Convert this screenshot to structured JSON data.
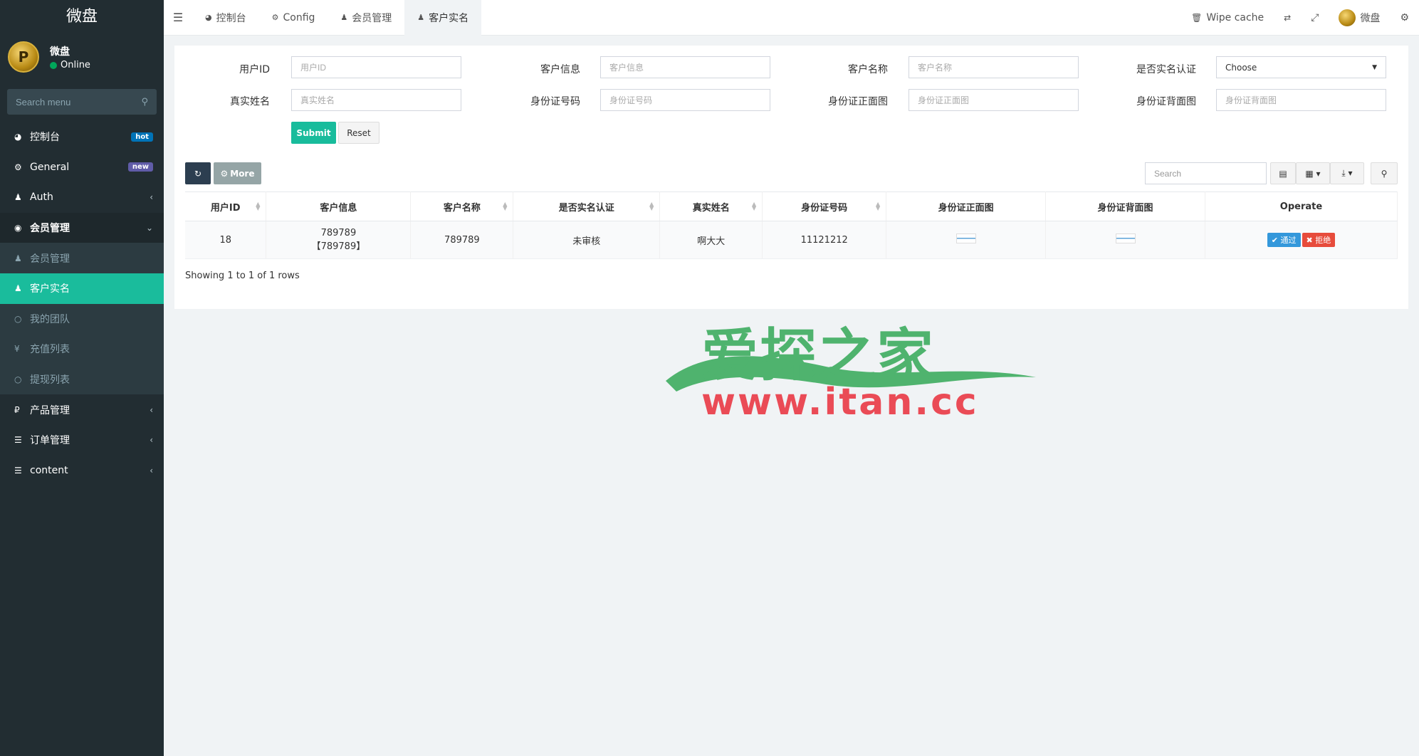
{
  "sidebar": {
    "brand": "微盘",
    "user": {
      "name": "微盘",
      "status": "Online",
      "avatar_letter": "P"
    },
    "search_placeholder": "Search menu",
    "items": [
      {
        "label": "控制台",
        "icon": "dashboard-icon",
        "badge": "hot"
      },
      {
        "label": "General",
        "icon": "cogs-icon",
        "badge": "new"
      },
      {
        "label": "Auth",
        "icon": "group-icon",
        "arrow": "‹"
      },
      {
        "label": "会员管理",
        "icon": "user-circle-icon",
        "arrow": "⌄"
      },
      {
        "label": "会员管理",
        "icon": "user-icon"
      },
      {
        "label": "客户实名",
        "icon": "user-icon"
      },
      {
        "label": "我的团队",
        "icon": "circle-icon"
      },
      {
        "label": "充值列表",
        "icon": "yen-icon"
      },
      {
        "label": "提现列表",
        "icon": "circle-icon"
      },
      {
        "label": "产品管理",
        "icon": "ruble-icon",
        "arrow": "‹"
      },
      {
        "label": "订单管理",
        "icon": "list-icon",
        "arrow": "‹"
      },
      {
        "label": "content",
        "icon": "list-icon",
        "arrow": "‹"
      }
    ]
  },
  "navbar": {
    "tabs": [
      {
        "label": "控制台"
      },
      {
        "label": "Config"
      },
      {
        "label": "会员管理"
      },
      {
        "label": "客户实名"
      }
    ],
    "wipe_cache": "Wipe cache",
    "user_name": "微盘"
  },
  "filter": {
    "fields": [
      {
        "label": "用户ID",
        "placeholder": "用户ID"
      },
      {
        "label": "客户信息",
        "placeholder": "客户信息"
      },
      {
        "label": "客户名称",
        "placeholder": "客户名称"
      },
      {
        "label": "是否实名认证",
        "select_value": "Choose"
      },
      {
        "label": "真实姓名",
        "placeholder": "真实姓名"
      },
      {
        "label": "身份证号码",
        "placeholder": "身份证号码"
      },
      {
        "label": "身份证正面图",
        "placeholder": "身份证正面图"
      },
      {
        "label": "身份证背面图",
        "placeholder": "身份证背面图"
      }
    ],
    "submit": "Submit",
    "reset": "Reset"
  },
  "toolbar": {
    "more": "More",
    "search_placeholder": "Search"
  },
  "table": {
    "headers": [
      "用户ID",
      "客户信息",
      "客户名称",
      "是否实名认证",
      "真实姓名",
      "身份证号码",
      "身份证正面图",
      "身份证背面图",
      "Operate"
    ],
    "rows": [
      {
        "id": "18",
        "info_line1": "789789",
        "info_line2": "【789789】",
        "name": "789789",
        "verified": "未审核",
        "real_name": "啊大大",
        "id_number": "11121212",
        "approve": "通过",
        "reject": "拒绝"
      }
    ],
    "pagination": "Showing 1 to 1 of 1 rows"
  },
  "watermark": {
    "cn": "爱探之家",
    "en": "www.itan.cc"
  },
  "colors": {
    "sidebar_bg": "#222d32",
    "accent": "#18bc9c",
    "approve": "#3498db",
    "reject": "#e74c3c"
  }
}
